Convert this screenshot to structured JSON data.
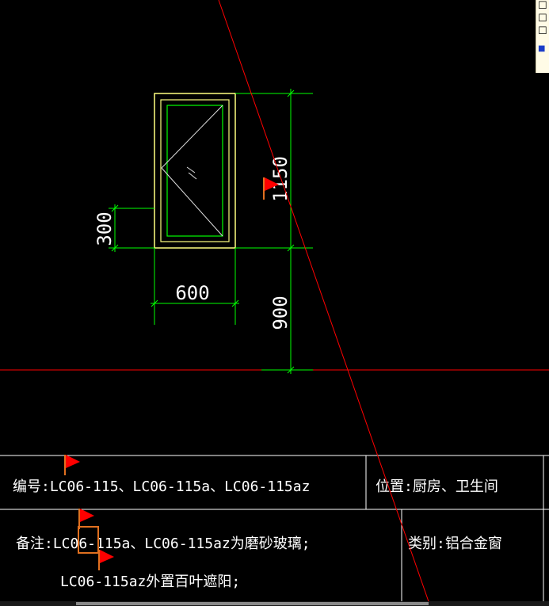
{
  "drawing": {
    "dimensions": {
      "window_width": "600",
      "window_height": "1150",
      "sill_height": "900",
      "lower_offset": "300"
    },
    "colors": {
      "background": "#000000",
      "frame": "#ffff80",
      "sash": "#00ff00",
      "dim_line": "#00ff00",
      "text": "#ffffff",
      "cut_line": "#ff0000",
      "table_line": "#ffffff",
      "flag": "#ff0000",
      "highlight": "#e07020"
    }
  },
  "title_block": {
    "code": "编号:LC06-115、LC06-115a、LC06-115az",
    "location": "位置:厨房、卫生间",
    "note_prefix": "备注:LC06-",
    "note_highlight": "115",
    "note_rest": "a、LC06-115az为磨砂玻璃;",
    "note_line2": "LC06-115az外置百叶遮阳;",
    "category": "类别:铝合金窗"
  },
  "markers": {
    "icon": "flag-icon"
  }
}
